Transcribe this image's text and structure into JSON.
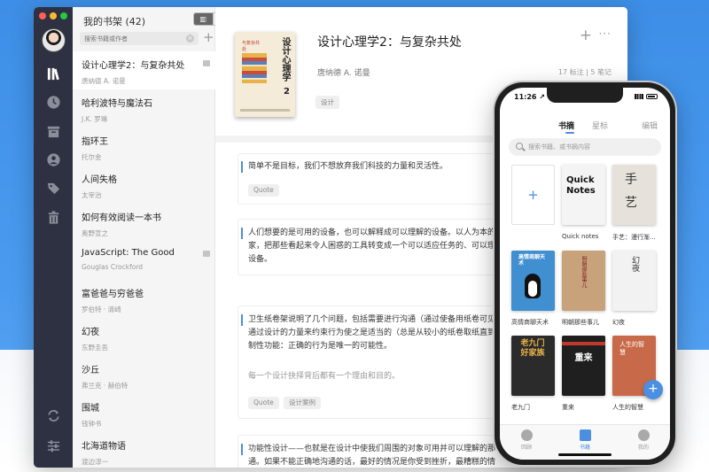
{
  "sidebar": {
    "icons": [
      "books-icon",
      "clock-icon",
      "inbox-icon",
      "user-icon",
      "tag-icon",
      "trash-icon",
      "sync-icon",
      "settings-icon"
    ]
  },
  "list_panel": {
    "title": "我的书架 (42)",
    "view_toggle": [
      "▥",
      "▬",
      "★"
    ],
    "search_placeholder": "搜索书籍或作者",
    "add_label": "+",
    "books": [
      {
        "title": "设计心理学2：与复杂共处",
        "author": "唐纳德 A. 诺曼",
        "has_notes": true
      },
      {
        "title": "哈利波特与魔法石",
        "author": "J.K. 罗琳",
        "has_notes": false
      },
      {
        "title": "指环王",
        "author": "托尔金",
        "has_notes": false
      },
      {
        "title": "人间失格",
        "author": "太宰治",
        "has_notes": false
      },
      {
        "title": "如何有效阅读一本书",
        "author": "奥野宣之",
        "has_notes": false
      },
      {
        "title": "JavaScript: The Good",
        "author": "Gouglas Crockford",
        "has_notes": true
      },
      {
        "title": "富爸爸与穷爸爸",
        "author": "罗伯特 · 清崎",
        "has_notes": false
      },
      {
        "title": "幻夜",
        "author": "东野圭吾",
        "has_notes": false
      },
      {
        "title": "沙丘",
        "author": "弗兰克 · 赫伯特",
        "has_notes": false
      },
      {
        "title": "围城",
        "author": "钱钟书",
        "has_notes": false
      },
      {
        "title": "北海道物语",
        "author": "渡边淳一",
        "has_notes": false
      }
    ]
  },
  "detail": {
    "cover_title": "设计心理学",
    "cover_number": "2",
    "cover_subtitle": "与复杂共处",
    "title": "设计心理学2：与复杂共处",
    "author": "唐纳德 A. 诺曼",
    "meta": "17 标注 | 5 笔记",
    "tag": "设计",
    "highlights": [
      {
        "lines": [
          "简单不是目标，我们不想放弃我们科技的力量和灵活性。"
        ],
        "note": "",
        "tags": [
          "Quote"
        ]
      },
      {
        "lines": [
          "人们想要的是可用的设备，也可以解释成可以理解的设备。以人为本的",
          "家，把那些看起来令人困惑的工具转变成一个可以适应任务的、可以理",
          "设备。"
        ],
        "note": "",
        "tags": []
      },
      {
        "lines": [
          "卫生纸卷架说明了几个问题，包括需要进行沟通（通过使备用纸卷可见",
          "通过设计的力量来约束行为使之是适当的（总是从较小的纸卷取纸直到",
          "制性功能：正确的行为是唯一的可能性。"
        ],
        "note": "每一个设计抉择背后都有一个理由和目的。",
        "tags": [
          "Quote",
          "设计案例"
        ]
      },
      {
        "lines": [
          "功能性设计——也就是在设计中使我们周围的对象可用并可以理解的那",
          "通。如果不能正确地沟通的话，最好的情况是你受到挫折，最糟糕的情"
        ],
        "note": "",
        "tags": []
      }
    ]
  },
  "phone": {
    "time": "11:26 ↗",
    "tabs": [
      "书摘",
      "星标"
    ],
    "edit": "编辑",
    "search_placeholder": "搜索书籍、或书摘内容",
    "books": [
      {
        "label": "",
        "cover_text": "+",
        "bg": "#ffffff"
      },
      {
        "label": "Quick notes",
        "cover_text": "Quick Notes",
        "bg": "#f4f4f4"
      },
      {
        "label": "手艺：漫行渐...",
        "cover_text": "手 艺",
        "bg": "#e6e2db"
      },
      {
        "label": "高情商聊天术",
        "cover_text": "高情商聊天术",
        "bg": "#3f8fd1"
      },
      {
        "label": "明朝那些事儿",
        "cover_text": "明朝那些事儿",
        "bg": "#c7a27a"
      },
      {
        "label": "幻夜",
        "cover_text": "幻夜",
        "bg": "#f2f2f2"
      },
      {
        "label": "老九门",
        "cover_text": "老九门 好家族",
        "bg": "#2b2b2b"
      },
      {
        "label": "重来",
        "cover_text": "重来",
        "bg": "#1f1f1f"
      },
      {
        "label": "人生的智慧",
        "cover_text": "人生的智慧",
        "bg": "#c86a4a"
      }
    ],
    "fab": "+",
    "nav": [
      {
        "label": "回顾"
      },
      {
        "label": "书籍"
      },
      {
        "label": "我的"
      }
    ]
  }
}
